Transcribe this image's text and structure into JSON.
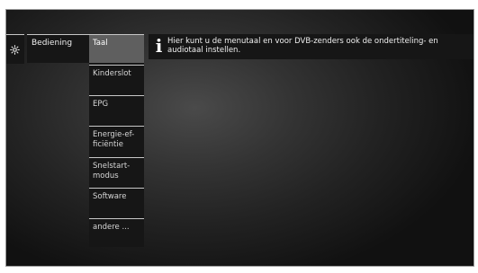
{
  "level1": {
    "icon": "gear-icon"
  },
  "level2": {
    "label": "Bediening"
  },
  "submenu": {
    "items": [
      {
        "label": "Taal",
        "selected": true
      },
      {
        "label": "Kinderslot",
        "selected": false
      },
      {
        "label": "EPG",
        "selected": false
      },
      {
        "label": "Energie-ef-\nficiëntie",
        "selected": false
      },
      {
        "label": "Snelstart-\nmodus",
        "selected": false
      },
      {
        "label": "Software",
        "selected": false
      },
      {
        "label": "andere ...",
        "selected": false
      }
    ]
  },
  "info": {
    "icon": "info-icon",
    "text": "Hier kunt u de menutaal en voor DVB-zenders ook de ondertiteling- en audiotaal instellen."
  },
  "colors": {
    "selected_background": "#5f5f5f",
    "panel_background": "#161616",
    "separator": "#c8c8c8"
  }
}
